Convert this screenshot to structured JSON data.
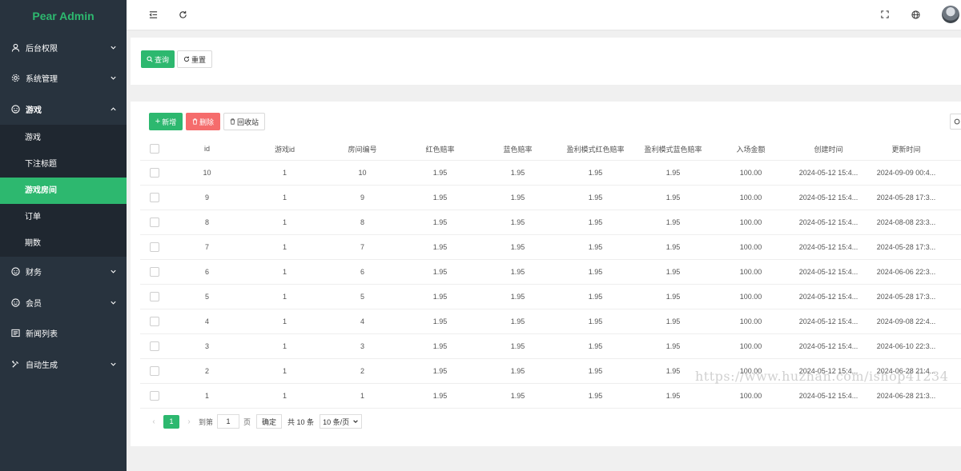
{
  "app": {
    "title": "Pear Admin"
  },
  "sidebar": {
    "items": [
      {
        "label": "后台权限",
        "icon": "user-icon",
        "expanded": false
      },
      {
        "label": "系统管理",
        "icon": "gear-icon",
        "expanded": false
      },
      {
        "label": "游戏",
        "icon": "smile-icon",
        "expanded": true
      },
      {
        "label": "财务",
        "icon": "smile-icon",
        "expanded": false
      },
      {
        "label": "会员",
        "icon": "smile-icon",
        "expanded": false
      },
      {
        "label": "新闻列表",
        "icon": "news-icon",
        "expanded": false
      },
      {
        "label": "自动生成",
        "icon": "tool-icon",
        "expanded": false
      }
    ],
    "game_submenu": [
      {
        "label": "游戏",
        "active": false
      },
      {
        "label": "下注标题",
        "active": false
      },
      {
        "label": "游戏房间",
        "active": true
      },
      {
        "label": "订单",
        "active": false
      },
      {
        "label": "期数",
        "active": false
      }
    ]
  },
  "header": {
    "icons": [
      "menu-fold-icon",
      "refresh-icon",
      "fullscreen-icon",
      "globe-icon",
      "avatar"
    ]
  },
  "search": {
    "query_label": "查询",
    "reset_label": "重置"
  },
  "toolbar": {
    "add_label": "新增",
    "delete_label": "删除",
    "recycle_label": "回收站"
  },
  "table": {
    "columns": [
      "id",
      "游戏id",
      "房间编号",
      "红色赔率",
      "蓝色赔率",
      "盈利模式红色赔率",
      "盈利模式蓝色赔率",
      "入场金额",
      "创建时间",
      "更新时间"
    ],
    "rows": [
      [
        "10",
        "1",
        "10",
        "1.95",
        "1.95",
        "1.95",
        "1.95",
        "100.00",
        "2024-05-12 15:4...",
        "2024-09-09 00:4..."
      ],
      [
        "9",
        "1",
        "9",
        "1.95",
        "1.95",
        "1.95",
        "1.95",
        "100.00",
        "2024-05-12 15:4...",
        "2024-05-28 17:3..."
      ],
      [
        "8",
        "1",
        "8",
        "1.95",
        "1.95",
        "1.95",
        "1.95",
        "100.00",
        "2024-05-12 15:4...",
        "2024-08-08 23:3..."
      ],
      [
        "7",
        "1",
        "7",
        "1.95",
        "1.95",
        "1.95",
        "1.95",
        "100.00",
        "2024-05-12 15:4...",
        "2024-05-28 17:3..."
      ],
      [
        "6",
        "1",
        "6",
        "1.95",
        "1.95",
        "1.95",
        "1.95",
        "100.00",
        "2024-05-12 15:4...",
        "2024-06-06 22:3..."
      ],
      [
        "5",
        "1",
        "5",
        "1.95",
        "1.95",
        "1.95",
        "1.95",
        "100.00",
        "2024-05-12 15:4...",
        "2024-05-28 17:3..."
      ],
      [
        "4",
        "1",
        "4",
        "1.95",
        "1.95",
        "1.95",
        "1.95",
        "100.00",
        "2024-05-12 15:4...",
        "2024-09-08 22:4..."
      ],
      [
        "3",
        "1",
        "3",
        "1.95",
        "1.95",
        "1.95",
        "1.95",
        "100.00",
        "2024-05-12 15:4...",
        "2024-06-10 22:3..."
      ],
      [
        "2",
        "1",
        "2",
        "1.95",
        "1.95",
        "1.95",
        "1.95",
        "100.00",
        "2024-05-12 15:4...",
        "2024-06-28 21:4..."
      ],
      [
        "1",
        "1",
        "1",
        "1.95",
        "1.95",
        "1.95",
        "1.95",
        "100.00",
        "2024-05-12 15:4...",
        "2024-06-28 21:3..."
      ]
    ]
  },
  "pagination": {
    "current_page": "1",
    "goto_label": "到第",
    "goto_value": "1",
    "page_unit": "页",
    "confirm_label": "确定",
    "total_label": "共 10 条",
    "page_size_label": "10 条/页"
  },
  "watermark": {
    "text": "https://www.huzhan.com/ishop41234"
  },
  "colors": {
    "primary": "#2db86f",
    "danger": "#f56c6c",
    "sidebar_bg": "#28333e",
    "submenu_bg": "#1f2730"
  }
}
